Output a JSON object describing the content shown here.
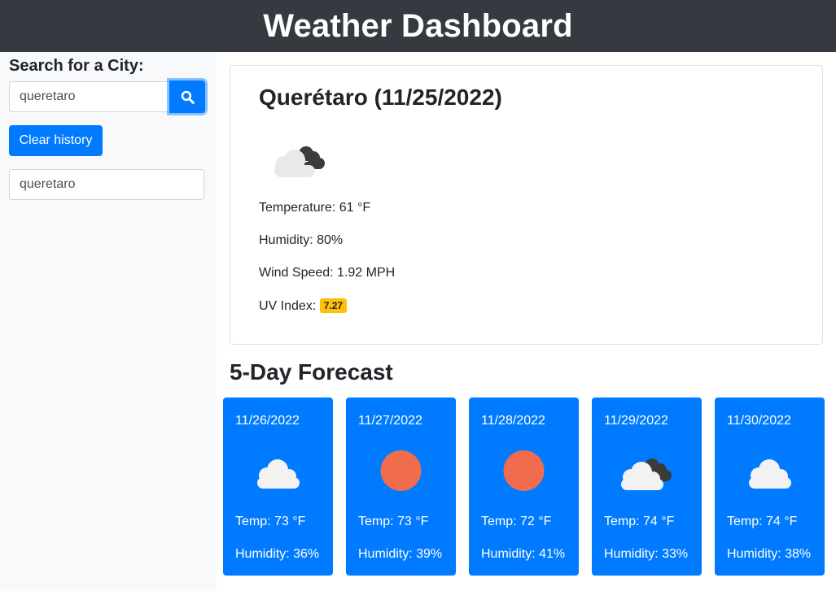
{
  "header": {
    "title": "Weather Dashboard"
  },
  "sidebar": {
    "label": "Search for a City:",
    "search_value": "queretaro",
    "search_icon": "search-icon",
    "clear_label": "Clear history",
    "history": [
      "queretaro"
    ]
  },
  "current": {
    "city_title": "Querétaro (11/25/2022)",
    "icon": "cloudy-icon",
    "temperature": "Temperature: 61 °F",
    "humidity": "Humidity: 80%",
    "wind": "Wind Speed: 1.92 MPH",
    "uv_label": "UV Index: ",
    "uv_value": "7.27",
    "uv_color": "#ffc107"
  },
  "forecast": {
    "title": "5-Day Forecast",
    "days": [
      {
        "date": "11/26/2022",
        "icon": "cloud-icon",
        "temp": "Temp: 73 °F",
        "humidity": "Humidity: 36%"
      },
      {
        "date": "11/27/2022",
        "icon": "sun-icon",
        "temp": "Temp: 73 °F",
        "humidity": "Humidity: 39%"
      },
      {
        "date": "11/28/2022",
        "icon": "sun-icon",
        "temp": "Temp: 72 °F",
        "humidity": "Humidity: 41%"
      },
      {
        "date": "11/29/2022",
        "icon": "broken-clouds-icon",
        "temp": "Temp: 74 °F",
        "humidity": "Humidity: 33%"
      },
      {
        "date": "11/30/2022",
        "icon": "cloud-icon",
        "temp": "Temp: 74 °F",
        "humidity": "Humidity: 38%"
      }
    ]
  },
  "colors": {
    "header_bg": "#343a40",
    "accent": "#007bff",
    "sun": "#ef6c4d",
    "uv_badge": "#ffc107"
  }
}
